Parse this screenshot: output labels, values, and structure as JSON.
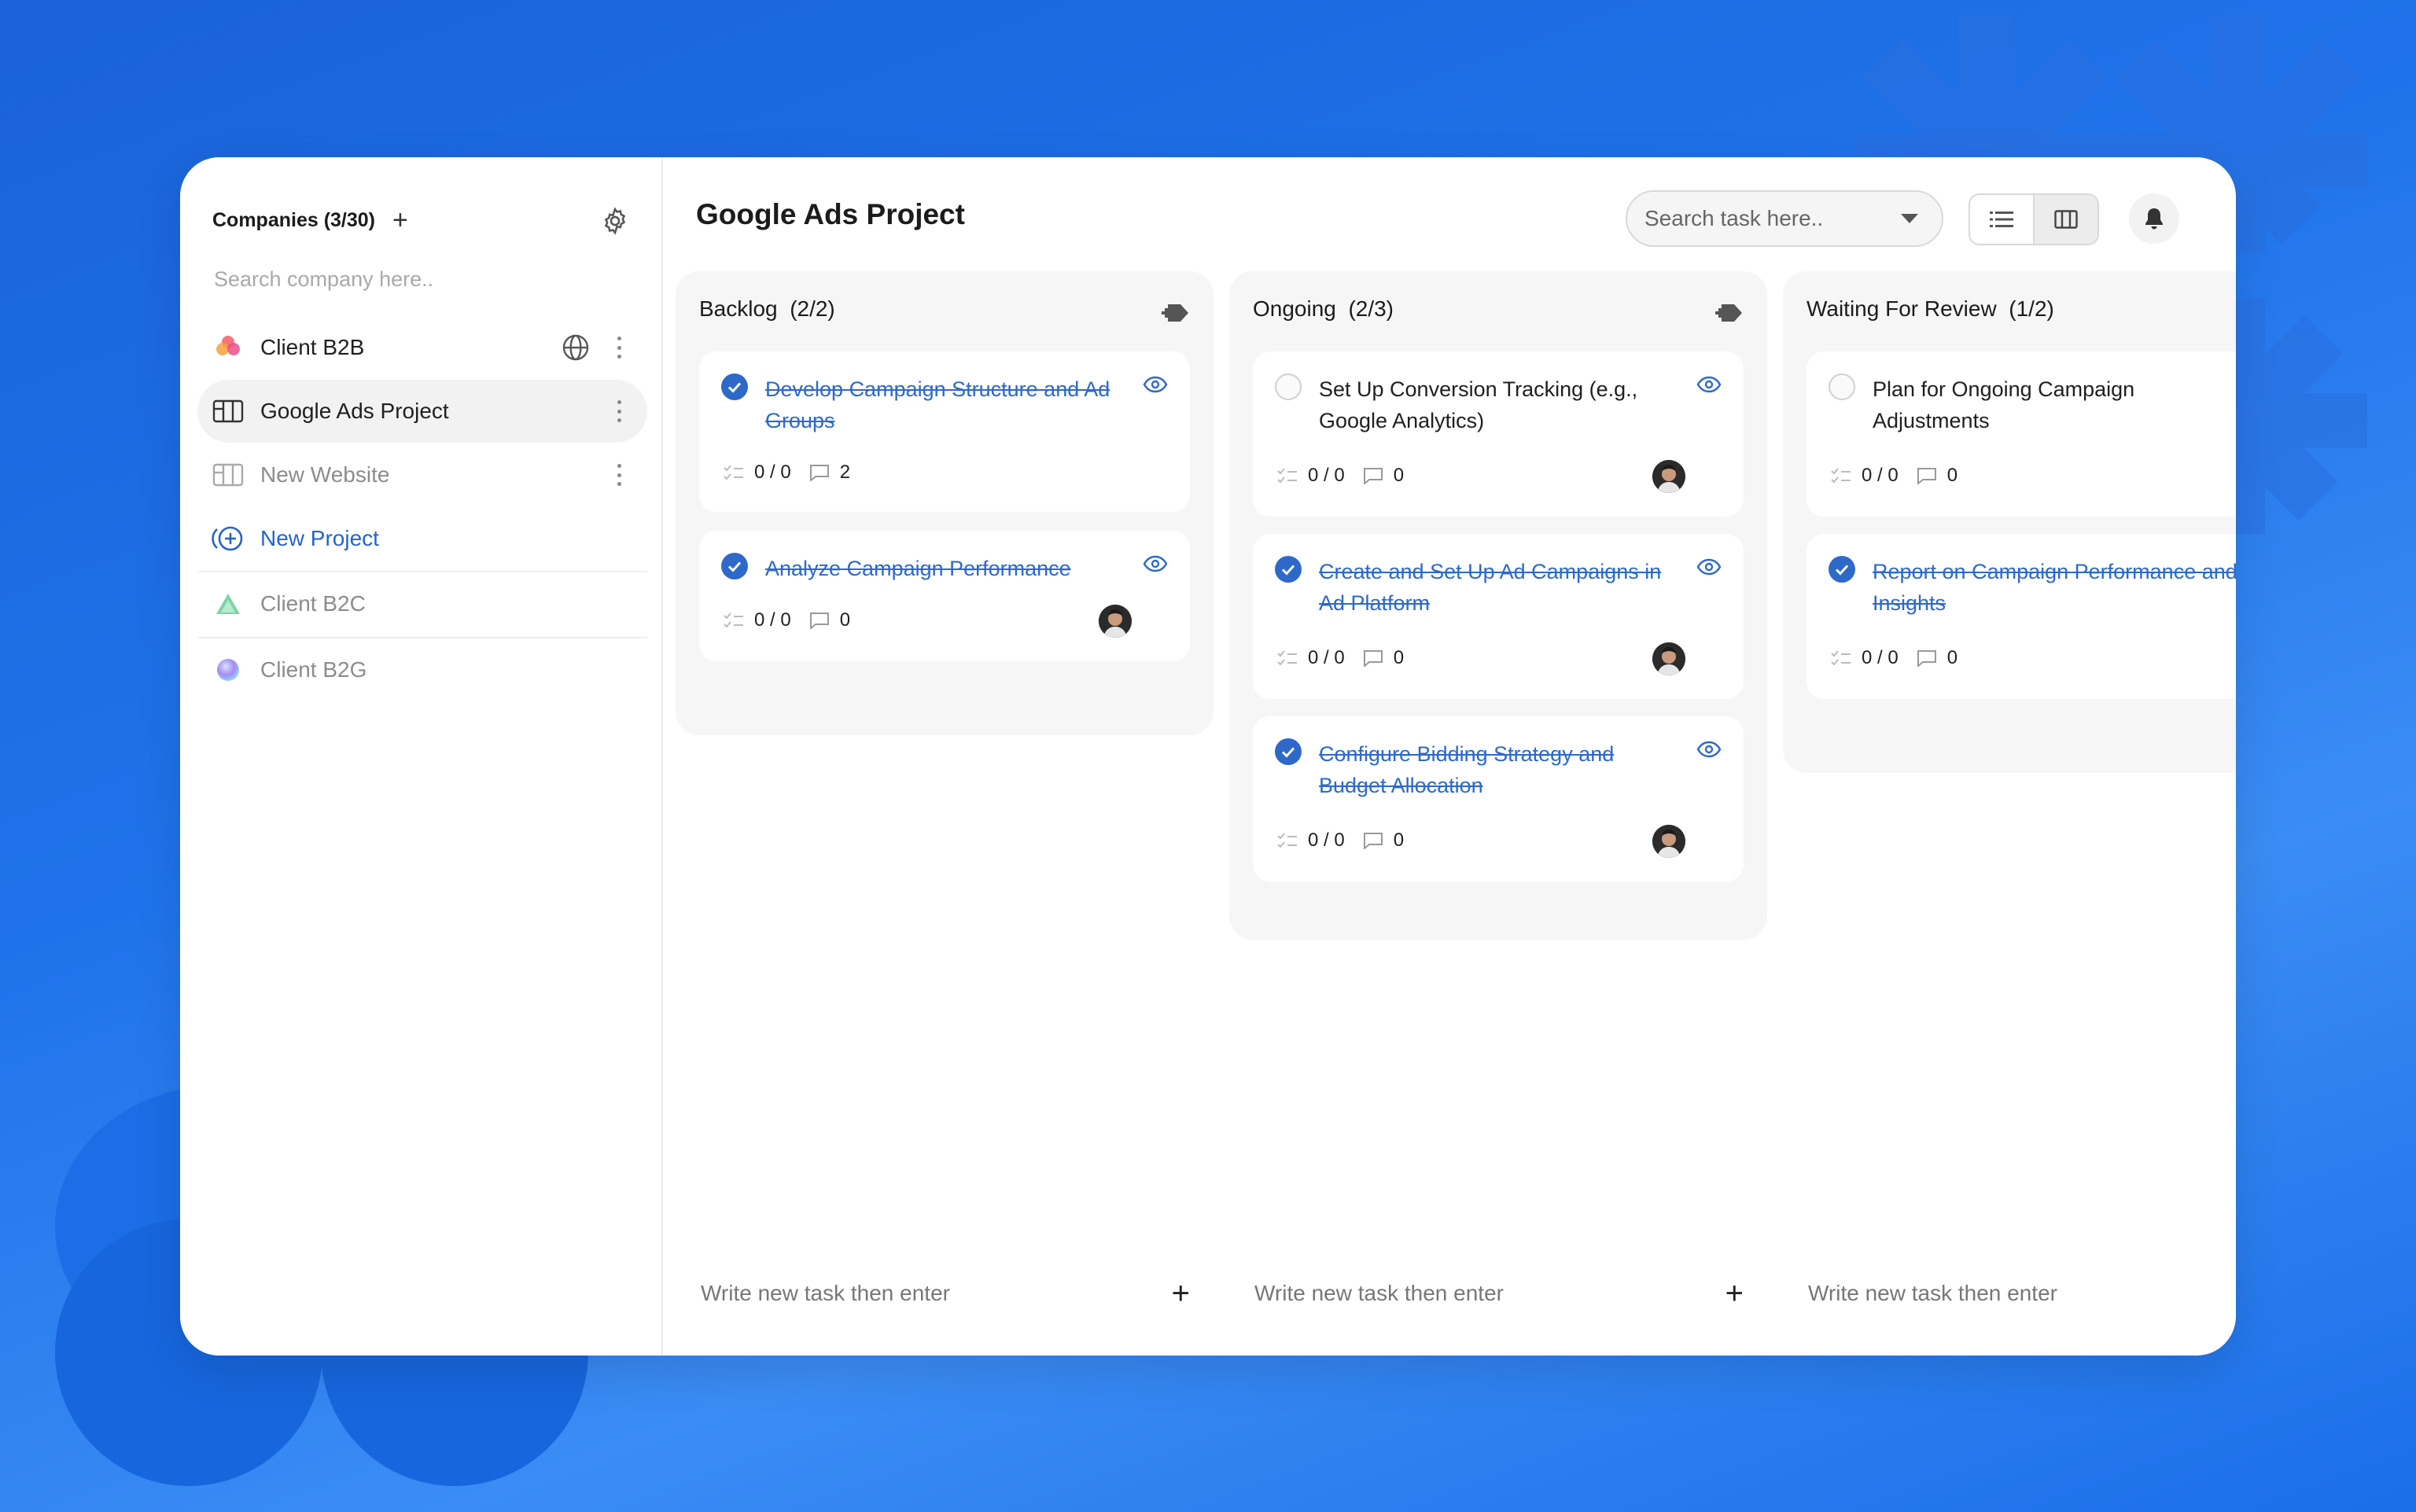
{
  "colors": {
    "accent": "#2e69c9",
    "background": "#1f73ea",
    "whatsapp": "#25d366",
    "sheets": "#1fa463"
  },
  "sidebar": {
    "title": "Companies (3/30)",
    "add_icon": "plus-icon",
    "settings_icon": "gear-icon",
    "search_placeholder": "Search company here..",
    "items": [
      {
        "label": "Client B2B",
        "icon": "flower-logo-icon",
        "type": "company"
      },
      {
        "label": "Google Ads Project",
        "icon": "board-icon",
        "type": "project",
        "active": true
      },
      {
        "label": "New Website",
        "icon": "board-icon",
        "type": "project"
      },
      {
        "label": "New Project",
        "icon": "add-circle-icon",
        "type": "action"
      },
      {
        "label": "Client B2C",
        "icon": "triangle-logo-icon",
        "type": "company"
      },
      {
        "label": "Client B2G",
        "icon": "orb-logo-icon",
        "type": "company"
      }
    ]
  },
  "header": {
    "title": "Google Ads Project",
    "search_placeholder": "Search task here..",
    "icons": [
      "whatsapp-icon",
      "sheets-icon",
      "list-view-icon",
      "board-view-icon",
      "bell-icon"
    ]
  },
  "columns": [
    {
      "title": "Backlog",
      "count": "(2/2)",
      "new_task_placeholder": "Write new task then enter",
      "cards": [
        {
          "title": "Develop Campaign Structure and Ad Groups",
          "done": true,
          "subtasks": "0 / 0",
          "comments": "2",
          "avatar": false
        },
        {
          "title": "Analyze Campaign Performance",
          "done": true,
          "subtasks": "0 / 0",
          "comments": "0",
          "avatar": true
        }
      ]
    },
    {
      "title": "Ongoing",
      "count": "(2/3)",
      "new_task_placeholder": "Write new task then enter",
      "cards": [
        {
          "title": "Set Up Conversion Tracking (e.g., Google Analytics)",
          "done": false,
          "subtasks": "0 / 0",
          "comments": "0",
          "avatar": true
        },
        {
          "title": "Create and Set Up Ad Campaigns in Ad Platform",
          "done": true,
          "subtasks": "0 / 0",
          "comments": "0",
          "avatar": true
        },
        {
          "title": "Configure Bidding Strategy and Budget Allocation",
          "done": true,
          "subtasks": "0 / 0",
          "comments": "0",
          "avatar": true
        }
      ]
    },
    {
      "title": "Waiting For Review",
      "count": "(1/2)",
      "new_task_placeholder": "Write new task then enter",
      "cards": [
        {
          "title": "Plan for Ongoing Campaign Adjustments",
          "done": false,
          "subtasks": "0 / 0",
          "comments": "0",
          "avatar": false
        },
        {
          "title": "Report on Campaign Performance and Insights",
          "done": true,
          "subtasks": "0 / 0",
          "comments": "0",
          "avatar": false
        }
      ]
    }
  ]
}
